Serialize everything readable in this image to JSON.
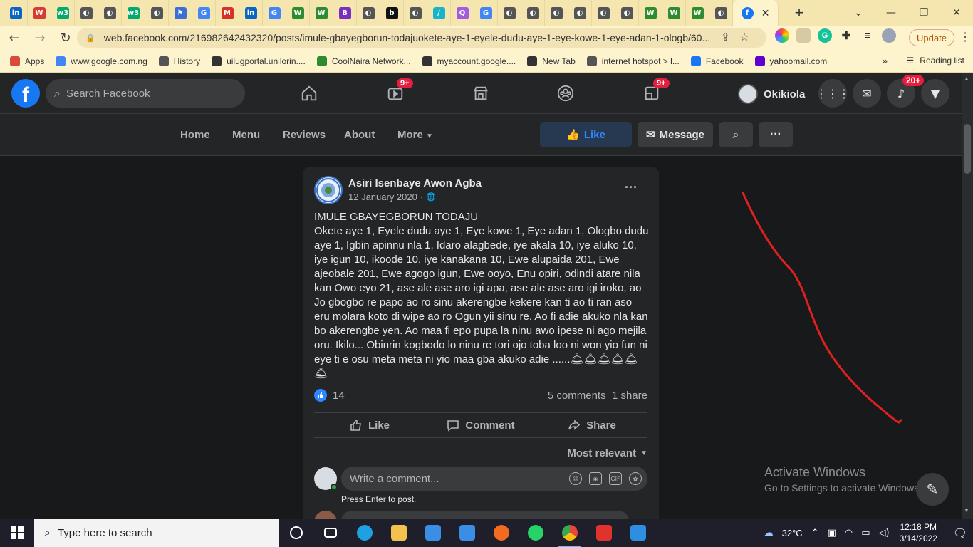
{
  "browser": {
    "tabs": [
      {
        "icon": "linkedin-icon",
        "glyph": "in",
        "color": "#0a66c2"
      },
      {
        "icon": "app-tab-icon",
        "glyph": "W",
        "color": "#d63c2f"
      },
      {
        "icon": "w3-icon",
        "glyph": "w3",
        "color": "#04aa6d"
      },
      {
        "icon": "globe-icon",
        "glyph": "◐",
        "color": "#555555"
      },
      {
        "icon": "globe-icon",
        "glyph": "◐",
        "color": "#555555"
      },
      {
        "icon": "w3-icon",
        "glyph": "w3",
        "color": "#04aa6d"
      },
      {
        "icon": "globe-icon",
        "glyph": "◐",
        "color": "#555555"
      },
      {
        "icon": "flag-icon",
        "glyph": "⚑",
        "color": "#3b6fd6"
      },
      {
        "icon": "google-icon",
        "glyph": "G",
        "color": "#4285f4"
      },
      {
        "icon": "gmail-icon",
        "glyph": "M",
        "color": "#d93025"
      },
      {
        "icon": "linkedin-icon",
        "glyph": "in",
        "color": "#0a66c2"
      },
      {
        "icon": "google-icon",
        "glyph": "G",
        "color": "#4285f4"
      },
      {
        "icon": "w-icon",
        "glyph": "W",
        "color": "#2e8b2e"
      },
      {
        "icon": "w-icon",
        "glyph": "W",
        "color": "#2e8b2e"
      },
      {
        "icon": "b-icon",
        "glyph": "B",
        "color": "#7b2fbf"
      },
      {
        "icon": "globe-icon",
        "glyph": "◐",
        "color": "#555555"
      },
      {
        "icon": "b-icon",
        "glyph": "b",
        "color": "#111111"
      },
      {
        "icon": "globe-icon",
        "glyph": "◐",
        "color": "#555555"
      },
      {
        "icon": "slash-icon",
        "glyph": "/",
        "color": "#18b4c9"
      },
      {
        "icon": "q-icon",
        "glyph": "Q",
        "color": "#a25ce0"
      },
      {
        "icon": "google-icon",
        "glyph": "G",
        "color": "#4285f4"
      },
      {
        "icon": "globe-icon",
        "glyph": "◐",
        "color": "#555555"
      },
      {
        "icon": "globe-icon",
        "glyph": "◐",
        "color": "#555555"
      },
      {
        "icon": "globe-icon",
        "glyph": "◐",
        "color": "#555555"
      },
      {
        "icon": "globe-icon",
        "glyph": "◐",
        "color": "#555555"
      },
      {
        "icon": "globe-icon",
        "glyph": "◐",
        "color": "#555555"
      },
      {
        "icon": "globe-icon",
        "glyph": "◐",
        "color": "#555555"
      },
      {
        "icon": "w-icon",
        "glyph": "W",
        "color": "#2e8b2e"
      },
      {
        "icon": "w-icon",
        "glyph": "W",
        "color": "#2e8b2e"
      },
      {
        "icon": "w-icon",
        "glyph": "W",
        "color": "#2e8b2e"
      },
      {
        "icon": "globe-icon",
        "glyph": "◐",
        "color": "#555555"
      }
    ],
    "active_tab": {
      "icon": "facebook-icon",
      "close": "✕"
    },
    "new_tab": "+",
    "window_controls": {
      "dropdown": "⌄",
      "minimize": "—",
      "restore": "❐",
      "close": "✕"
    },
    "nav": {
      "back": "←",
      "forward": "→",
      "reload": "↻"
    },
    "url": "web.facebook.com/216982642432320/posts/imule-gbayegborun-todajuokete-aye-1-eyele-dudu-aye-1-eye-kowe-1-eye-adan-1-ologb/60...",
    "update_label": "Update",
    "bookmarks": [
      {
        "label": "Apps",
        "icon": "apps-grid-icon",
        "color": "#d84a3a"
      },
      {
        "label": "www.google.com.ng",
        "icon": "google-icon",
        "color": "#4285f4"
      },
      {
        "label": "History",
        "icon": "history-icon",
        "color": "#555555"
      },
      {
        "label": "uilugportal.unilorin....",
        "icon": "globe-icon",
        "color": "#333333"
      },
      {
        "label": "CoolNaira Network...",
        "icon": "naira-icon",
        "color": "#2e8b2e"
      },
      {
        "label": "myaccount.google....",
        "icon": "globe-icon",
        "color": "#333333"
      },
      {
        "label": "New Tab",
        "icon": "globe-icon",
        "color": "#333333"
      },
      {
        "label": "internet hotspot > l...",
        "icon": "hotspot-icon",
        "color": "#555555"
      },
      {
        "label": "Facebook",
        "icon": "facebook-icon",
        "color": "#1877f2"
      },
      {
        "label": "yahoomail.com",
        "icon": "yahoo-icon",
        "color": "#6001d2"
      }
    ],
    "bookmarks_overflow": "»",
    "reading_list": "Reading list"
  },
  "facebook": {
    "search_placeholder": "Search Facebook",
    "nav_badges": {
      "watch": "9+",
      "gaming": "9+",
      "notifications": "20+"
    },
    "profile_name": "Okikiola",
    "page_nav": {
      "home": "Home",
      "menu": "Menu",
      "reviews": "Reviews",
      "about": "About",
      "more": "More",
      "like": "Like",
      "message": "Message"
    },
    "post": {
      "author": "Asiri Isenbaye Awon Agba",
      "date": "12 January 2020",
      "text": "IMULE GBAYEGBORUN TODAJU\nOkete aye 1, Eyele dudu aye 1, Eye kowe 1, Eye adan 1, Ologbo dudu aye 1, Igbin apinnu nla 1, Idaro alagbede, iye akala 10, iye aluko 10, iye igun 10, ikoode 10, iye kanakana 10, Ewe alupaida 201, Ewe ajeobale 201, Ewe agogo igun, Ewe  ooyo, Enu opiri, odindi atare nila kan Owo eyo 21, ase ale ase aro igi apa, ase ale ase aro igi iroko, ao Jo gbogbo re papo ao ro sinu akerengbe kekere kan ti ao ti ran aso eru molara koto di wipe ao ro Ogun yii sinu re. Ao fi adie akuko nla kan bo akerengbe yen. Ao maa fi epo pupa la ninu awo ipese ni ago mejila oru. Ikilo... Obinrin kogbodo lo ninu re tori ojo toba loo ni won yio fun ni eye ti e osu meta meta ni yio maa gba akuko adie ......🛎🛎🛎🛎🛎\n🛎",
      "likes": "14",
      "comments": "5 comments",
      "shares": "1 share",
      "actions": {
        "like": "Like",
        "comment": "Comment",
        "share": "Share"
      },
      "sort": "Most relevant",
      "comment_placeholder": "Write a comment...",
      "press_enter": "Press Enter to post."
    }
  },
  "windows_overlay": {
    "title": "Activate Windows",
    "subtitle": "Go to Settings to activate Windows."
  },
  "taskbar": {
    "search_placeholder": "Type here to search",
    "apps": [
      {
        "icon": "cortana-icon",
        "color": "#ffffff"
      },
      {
        "icon": "task-view-icon",
        "color": "#ffffff"
      },
      {
        "icon": "edge-icon",
        "color": "#1fa0e0"
      },
      {
        "icon": "file-explorer-icon",
        "color": "#f2c14e"
      },
      {
        "icon": "store-icon",
        "color": "#3b8ee6"
      },
      {
        "icon": "mail-icon",
        "color": "#3b8ee6"
      },
      {
        "icon": "brave-icon",
        "color": "#f36a21"
      },
      {
        "icon": "whatsapp-icon",
        "color": "#25d366"
      },
      {
        "icon": "chrome-icon",
        "color": "#e8453c"
      },
      {
        "icon": "wps-icon",
        "color": "#e2322c"
      },
      {
        "icon": "vscode-icon",
        "color": "#2e8fe0"
      }
    ],
    "weather": "32°C",
    "time": "12:18 PM",
    "date": "3/14/2022"
  }
}
